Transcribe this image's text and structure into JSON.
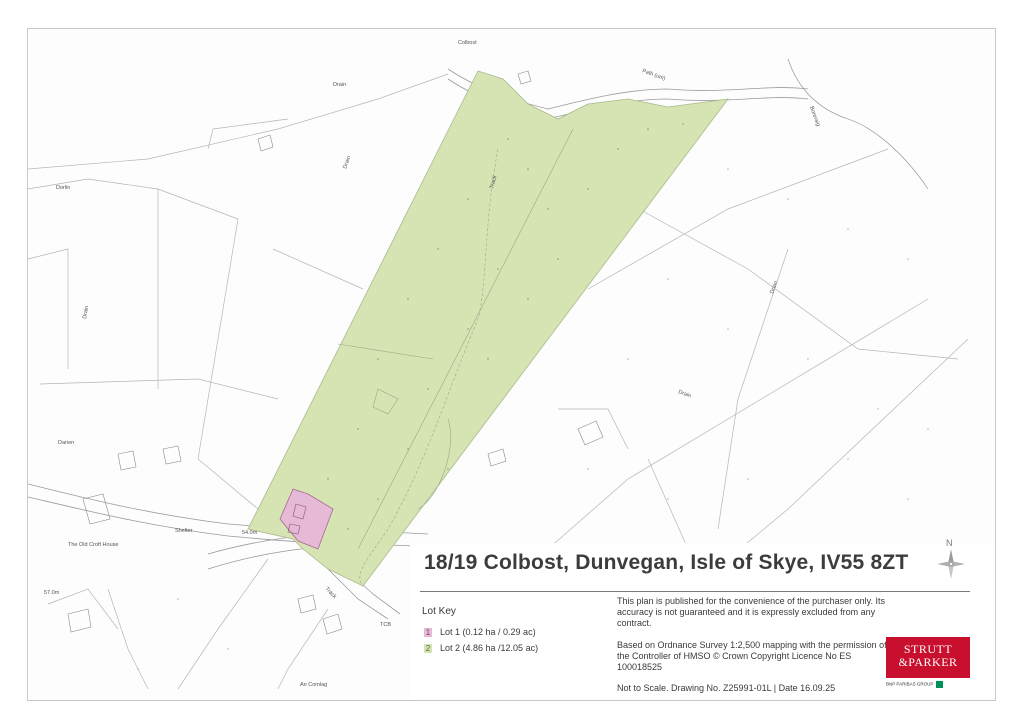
{
  "title": "18/19 Colbost, Dunvegan, Isle of Skye, IV55 8ZT",
  "compass": {
    "label": "N",
    "icon": "north-arrow-icon"
  },
  "lot_key": {
    "heading": "Lot Key",
    "lots": [
      {
        "number": "1",
        "label": "Lot 1 (0.12 ha / 0.29 ac)",
        "color": "#e6b9d6"
      },
      {
        "number": "2",
        "label": "Lot 2 (4.86 ha /12.05 ac)",
        "color": "#d6e4b4"
      }
    ]
  },
  "disclaimer": "This plan is published for the convenience of the purchaser only. Its accuracy is not guaranteed and it is expressly excluded from any contract.",
  "os_notice": "Based on Ordnance Survey 1:2,500 mapping with the permission of the Controller of HMSO © Crown Copyright Licence No ES 100018525",
  "drawing_info": "Not to Scale. Drawing No. Z25991-01L | Date 16.09.25",
  "logo": {
    "line1": "STRUTT",
    "line2": "&PARKER",
    "group": "BNP PARIBAS GROUP",
    "color": "#c8102e"
  },
  "map_labels": {
    "colbost": "Colbost",
    "drain1": "Drain",
    "drain2": "Drain",
    "drain3": "Drain",
    "drain4": "Drain",
    "drain5": "Drain",
    "track1": "Track",
    "track2": "Track",
    "dorlin": "Dorlin",
    "darien": "Darien",
    "shelter": "Shelter",
    "old_croft": "The Old Croft House",
    "spot1": "54.0m",
    "spot2": "57.0m",
    "tcb": "TCB",
    "an_comlag": "An Comlag",
    "path_um": "Path (um)",
    "boreraig": "Boreraig"
  }
}
